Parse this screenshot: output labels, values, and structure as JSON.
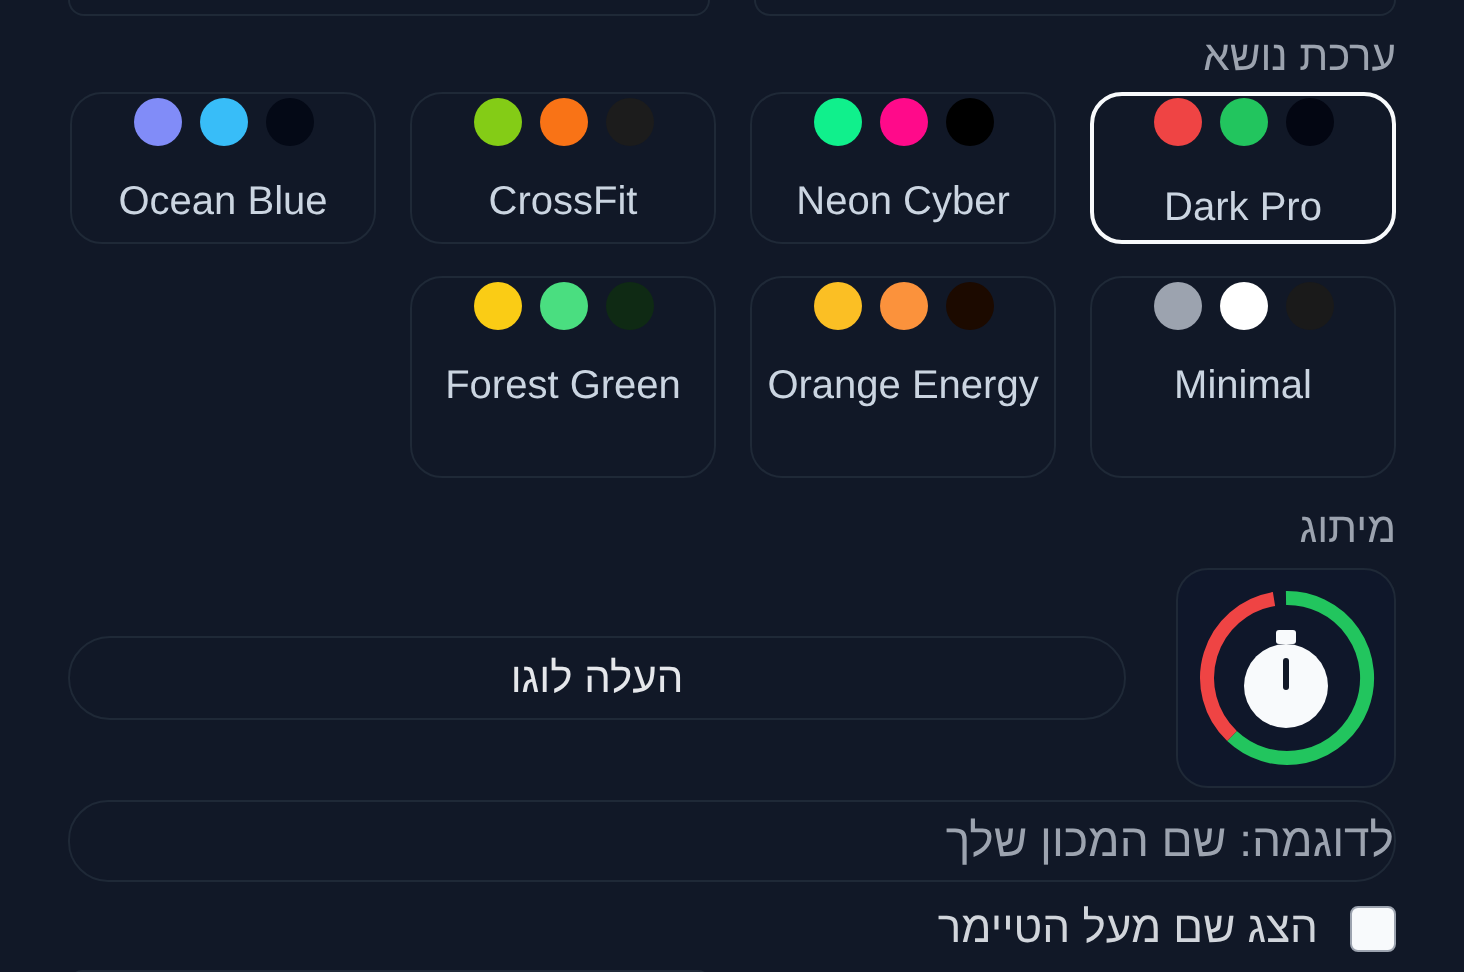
{
  "theme_section": {
    "label": "ערכת נושא",
    "themes": [
      {
        "name": "Dark Pro",
        "selected": true,
        "swatches": [
          {
            "color": "#ef4444"
          },
          {
            "color": "#22c55e"
          },
          {
            "color": "#030612"
          }
        ]
      },
      {
        "name": "Neon Cyber",
        "selected": false,
        "swatches": [
          {
            "color": "#10f08c"
          },
          {
            "color": "#ff0a8a"
          },
          {
            "color": "#000000"
          }
        ]
      },
      {
        "name": "CrossFit",
        "selected": false,
        "swatches": [
          {
            "color": "#84cc16"
          },
          {
            "color": "#f97316"
          },
          {
            "color": "#1c1c1c"
          }
        ]
      },
      {
        "name": "Ocean Blue",
        "selected": false,
        "swatches": [
          {
            "color": "#818cf8"
          },
          {
            "color": "#38bdf8"
          },
          {
            "color": "#040916"
          }
        ]
      },
      {
        "name": "Minimal",
        "selected": false,
        "swatches": [
          {
            "color": "#9ca3af"
          },
          {
            "color": "#ffffff"
          },
          {
            "color": "#1a1a1a"
          }
        ]
      },
      {
        "name": "Orange Energy",
        "selected": false,
        "swatches": [
          {
            "color": "#fbbf24"
          },
          {
            "color": "#fb923c"
          },
          {
            "color": "#1c0a00"
          }
        ]
      },
      {
        "name": "Forest Green",
        "selected": false,
        "swatches": [
          {
            "color": "#facc15"
          },
          {
            "color": "#4ade80"
          },
          {
            "color": "#0f2a14"
          }
        ]
      }
    ]
  },
  "branding": {
    "label": "מיתוג",
    "upload_button": "העלה לוגו",
    "name_field": {
      "placeholder": "לדוגמה: שם המכון שלך"
    },
    "show_name": {
      "label": "הצג שם מעל הטיימר",
      "checked": false
    }
  }
}
